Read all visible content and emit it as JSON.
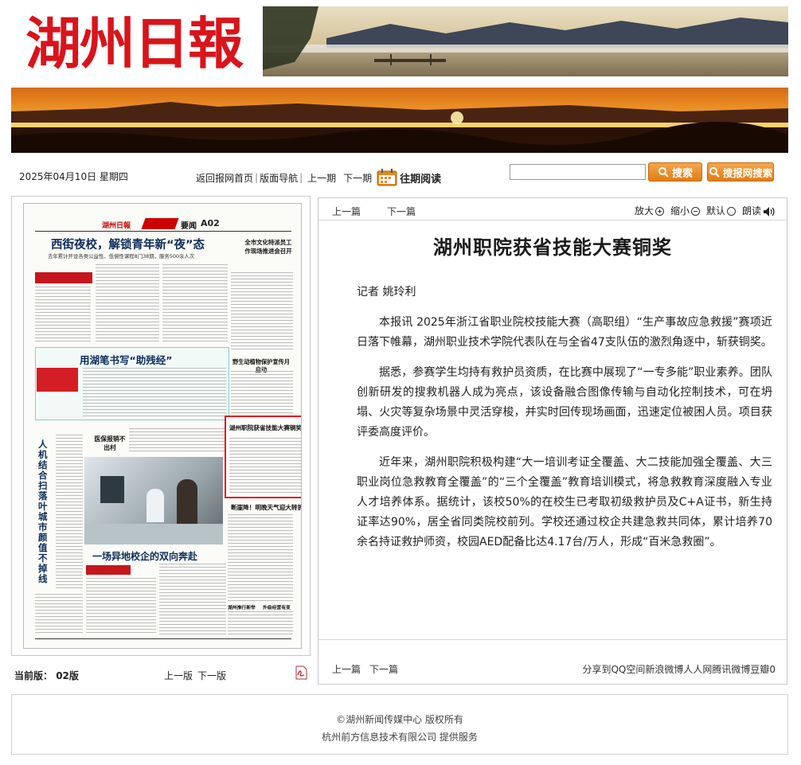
{
  "masthead": {
    "logo_text": "湖州日報"
  },
  "toolbar": {
    "date": "2025年04月10日 星期四",
    "back_home": "返回报网首页",
    "layout_nav": "版面导航",
    "prev_issue": "上一期",
    "next_issue": "下一期",
    "past_reading": "往期阅读",
    "search_button": "搜索",
    "sogou_button": "搜报网搜索",
    "search_value": ""
  },
  "paper": {
    "header_name": "湖州日報",
    "section": "要闻",
    "page_code": "A02",
    "headline_1": "西街夜校，解锁青年新“夜”态",
    "subhead_1": "去年累计开设各类公益性、低偿性课程8门38期，服务500余人次",
    "side_headline_1": "全市文化特派员工作现场推进会召开",
    "headline_2": "用湖笔书写“助残经”",
    "side_headline_2": "野生动植物保护宣传月启动",
    "highlighted_headline": "湖州职院获省技能大赛铜奖",
    "vertical_headline": "人机结合扫落叶 城市颜值不掉线",
    "medical_headline": "医保报销不出村",
    "weather_headline": "断崖降！明晚天气迎大转折",
    "bottom_headline": "一场异地校企的双向奔赴",
    "small_headline_a": "湖州推行新举",
    "small_headline_b": "外级经营有变"
  },
  "page_footer": {
    "current_label": "当前版：",
    "current_page": "02版",
    "prev_page": "上一版",
    "next_page": "下一版"
  },
  "article": {
    "top_prev": "上一篇",
    "top_next": "下一篇",
    "zoom_in": "放大",
    "zoom_out": "缩小",
    "default": "默认",
    "read_aloud": "朗读",
    "title": "湖州职院获省技能大赛铜奖",
    "byline": "记者  姚玲利",
    "paragraphs": [
      "本报讯  2025年浙江省职业院校技能大赛（高职组）“生产事故应急救援”赛项近日落下帷幕，湖州职业技术学院代表队在与全省47支队伍的激烈角逐中，斩获铜奖。",
      "据悉，参赛学生均持有救护员资质，在比赛中展现了“一专多能”职业素养。团队创新研发的搜救机器人成为亮点，该设备融合图像传输与自动化控制技术，可在坍塌、火灾等复杂场景中灵活穿梭，并实时回传现场画面，迅速定位被困人员。项目获评委高度评价。",
      "近年来，湖州职院积极构建“大一培训考证全覆盖、大二技能加强全覆盖、大三职业岗位急救教育全覆盖”的“三个全覆盖”教育培训模式，将急救教育深度融入专业人才培养体系。据统计，该校50%的在校生已考取初级救护员及C+A证书，新生持证率达90%，居全省同类院校前列。学校还通过校企共建急救共同体，累计培养70余名持证救护师资，校园AED配备比达4.17台/万人，形成“百米急救圈”。"
    ],
    "bottom_prev": "上一篇",
    "bottom_next": "下一篇",
    "share": "分享到QQ空间新浪微博人人网腾讯微博豆瓣0"
  },
  "footer": {
    "copyright": "©湖州新闻传媒中心 版权所有",
    "provider": "杭州前方信息技术有限公司   提供服务"
  },
  "colors": {
    "logo_red": "#d9141b",
    "accent_orange": "#e8861f",
    "highlight_frame": "#e0161c"
  }
}
